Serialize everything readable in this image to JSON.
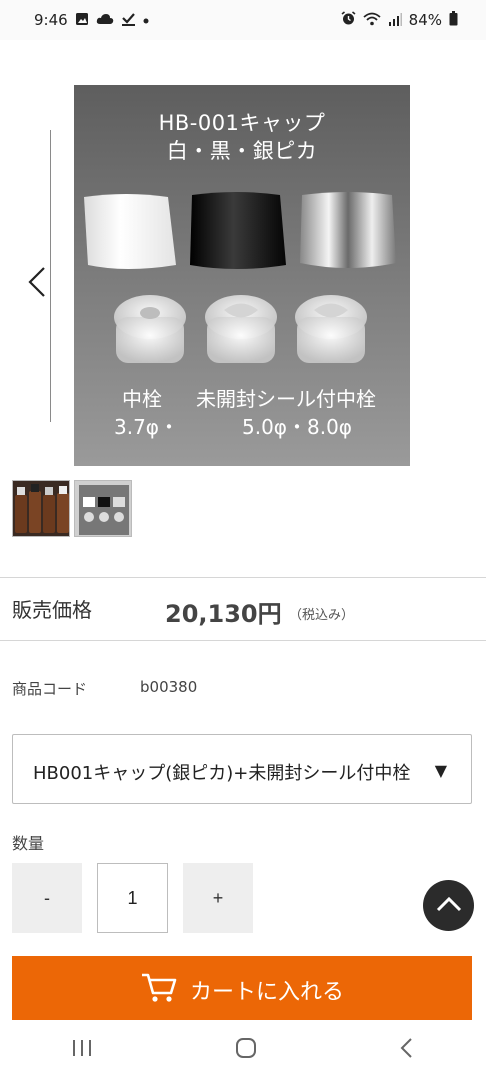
{
  "status_bar": {
    "time": "9:46",
    "battery": "84%",
    "left_icons": [
      "image-icon",
      "cloud-icon",
      "download-check-icon",
      "dot-icon"
    ],
    "right_icons": [
      "alarm-icon",
      "wifi-icon",
      "signal-icon",
      "battery-icon"
    ]
  },
  "product_image": {
    "title_line1": "HB-001キャップ",
    "title_line2": "白・黒・銀ピカ",
    "caption_left_line1": "中栓",
    "caption_left_line2": "3.7φ・",
    "caption_right_line1": "未開封シール付中栓",
    "caption_right_line2": "5.0φ・8.0φ"
  },
  "thumbnails": [
    {
      "name": "brown-bottles-thumbnail",
      "selected": false
    },
    {
      "name": "caps-thumbnail",
      "selected": true
    }
  ],
  "price": {
    "label": "販売価格",
    "value": "20,130円",
    "tax": "（税込み）"
  },
  "product_code": {
    "label": "商品コード",
    "value": "b00380"
  },
  "variant_select": {
    "selected": "HB001キャップ(銀ピカ)+未開封シール付中栓"
  },
  "quantity": {
    "label": "数量",
    "minus": "-",
    "value": "1",
    "plus": "+"
  },
  "cart_button": {
    "label": "カートに入れる"
  },
  "colors": {
    "accent_orange": "#ec6706",
    "back_to_top_bg": "#2b2b2b"
  }
}
